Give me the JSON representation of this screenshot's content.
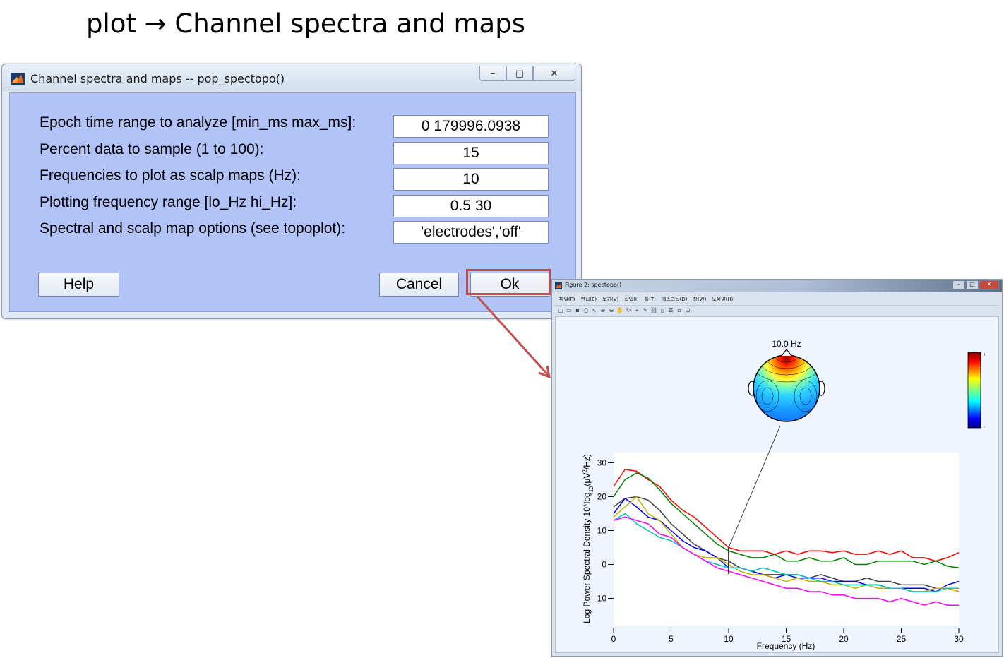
{
  "slide": {
    "title": "plot → Channel spectra and maps"
  },
  "dialog": {
    "title": "Channel spectra and maps -- pop_spectopo()",
    "window_buttons": {
      "minimize": "–",
      "maximize": "□",
      "close": "✕"
    },
    "fields": [
      {
        "label": "Epoch time range to analyze [min_ms max_ms]:",
        "value": "0 179996.0938"
      },
      {
        "label": "Percent data to sample (1 to 100):",
        "value": "15"
      },
      {
        "label": "Frequencies to plot as scalp maps (Hz):",
        "value": "10"
      },
      {
        "label": "Plotting frequency range [lo_Hz hi_Hz]:",
        "value": "0.5 30"
      },
      {
        "label": "Spectral and scalp map options (see topoplot):",
        "value": "'electrodes','off'"
      }
    ],
    "buttons": {
      "help": "Help",
      "cancel": "Cancel",
      "ok": "Ok"
    },
    "highlight_color": "#c0504d"
  },
  "figure": {
    "title": "Figure 2: spectopo()",
    "window_buttons": {
      "minimize": "–",
      "maximize": "□",
      "close": "✕"
    },
    "menu": [
      "파일(F)",
      "편집(E)",
      "보기(V)",
      "삽입(I)",
      "툴(T)",
      "데스크탑(D)",
      "창(W)",
      "도움말(H)"
    ],
    "toolbar_icons": [
      "new-icon",
      "open-icon",
      "save-icon",
      "print-icon",
      "pointer-icon",
      "zoom-in-icon",
      "zoom-out-icon",
      "pan-icon",
      "rotate-icon",
      "datacursor-icon",
      "brush-icon",
      "link-icon",
      "colorbar-icon",
      "legend-icon",
      "hide-icon",
      "dock-icon"
    ],
    "scalp_map_title": "10.0 Hz",
    "colorbar_labels": {
      "top": "+",
      "bottom": "-"
    }
  },
  "chart_data": {
    "type": "line",
    "xlabel": "Frequency (Hz)",
    "ylabel_parts": {
      "main": "Log Power Spectral Density 10*log",
      "sub": "10",
      "mid": "(μV",
      "sup": "2",
      "end": "/Hz)"
    },
    "xlim": [
      0,
      30
    ],
    "ylim": [
      -18,
      33
    ],
    "xticks": [
      0,
      5,
      10,
      15,
      20,
      25,
      30
    ],
    "yticks": [
      -10,
      0,
      10,
      20,
      30
    ],
    "marker_frequency": 10,
    "x": [
      0,
      1,
      2,
      3,
      4,
      5,
      6,
      7,
      8,
      9,
      10,
      11,
      12,
      13,
      14,
      15,
      16,
      17,
      18,
      19,
      20,
      21,
      22,
      23,
      24,
      25,
      26,
      27,
      28,
      29,
      30
    ],
    "series": [
      {
        "color": "#ff0000",
        "values": [
          23,
          28,
          27.5,
          25,
          23,
          19,
          16,
          14,
          11,
          8,
          5,
          4,
          4,
          4,
          3,
          4,
          3,
          4,
          4,
          3.5,
          4,
          3,
          3,
          4,
          3,
          4,
          2,
          2,
          1,
          2,
          3.5
        ]
      },
      {
        "color": "#008000",
        "values": [
          20,
          25,
          27,
          25.5,
          22,
          18,
          15,
          12,
          9,
          6,
          4,
          3,
          2,
          2,
          3,
          1,
          1,
          2,
          1,
          1,
          2,
          0,
          0,
          1,
          1,
          1,
          1,
          0,
          1,
          -0.5,
          -1
        ]
      },
      {
        "color": "#404040",
        "values": [
          17,
          19.5,
          20,
          19,
          16,
          12,
          9,
          6,
          4,
          2,
          1,
          -1,
          -2,
          -3,
          -3,
          -3,
          -3,
          -4,
          -3,
          -4,
          -5,
          -5,
          -4,
          -5,
          -5,
          -6,
          -6,
          -6,
          -7,
          -7,
          -8
        ]
      },
      {
        "color": "#0000ff",
        "values": [
          15,
          19.5,
          17,
          14,
          13,
          10,
          7,
          5,
          4,
          2,
          -1,
          -1,
          -2,
          -3,
          -4,
          -3,
          -4,
          -4,
          -4,
          -5,
          -5,
          -5,
          -6,
          -6,
          -7,
          -7,
          -7,
          -7,
          -8,
          -6,
          -5
        ]
      },
      {
        "color": "#c0b000",
        "values": [
          14,
          17,
          20,
          15,
          13,
          9,
          5,
          3,
          2,
          2,
          0,
          -2,
          -3,
          -3,
          -4,
          -5,
          -4,
          -5,
          -5,
          -6,
          -6,
          -7,
          -6,
          -7,
          -7,
          -7,
          -8,
          -8,
          -7,
          -7,
          -8
        ]
      },
      {
        "color": "#00c0c0",
        "values": [
          13,
          15,
          12,
          10,
          8,
          7,
          5,
          3,
          1,
          0,
          -1,
          -1,
          -2,
          -1,
          -2,
          -3,
          -3,
          -4,
          -5,
          -5,
          -6,
          -6,
          -6,
          -6,
          -7,
          -7,
          -8,
          -8,
          -8,
          -7,
          -7
        ]
      },
      {
        "color": "#ff00ff",
        "values": [
          13,
          14,
          13,
          12,
          9,
          8,
          5,
          3,
          1,
          -1,
          -2,
          -3,
          -4,
          -5,
          -6,
          -7,
          -7,
          -8,
          -8,
          -9,
          -9,
          -10,
          -10,
          -10,
          -11,
          -10,
          -11,
          -12,
          -11,
          -12,
          -12
        ]
      }
    ]
  }
}
